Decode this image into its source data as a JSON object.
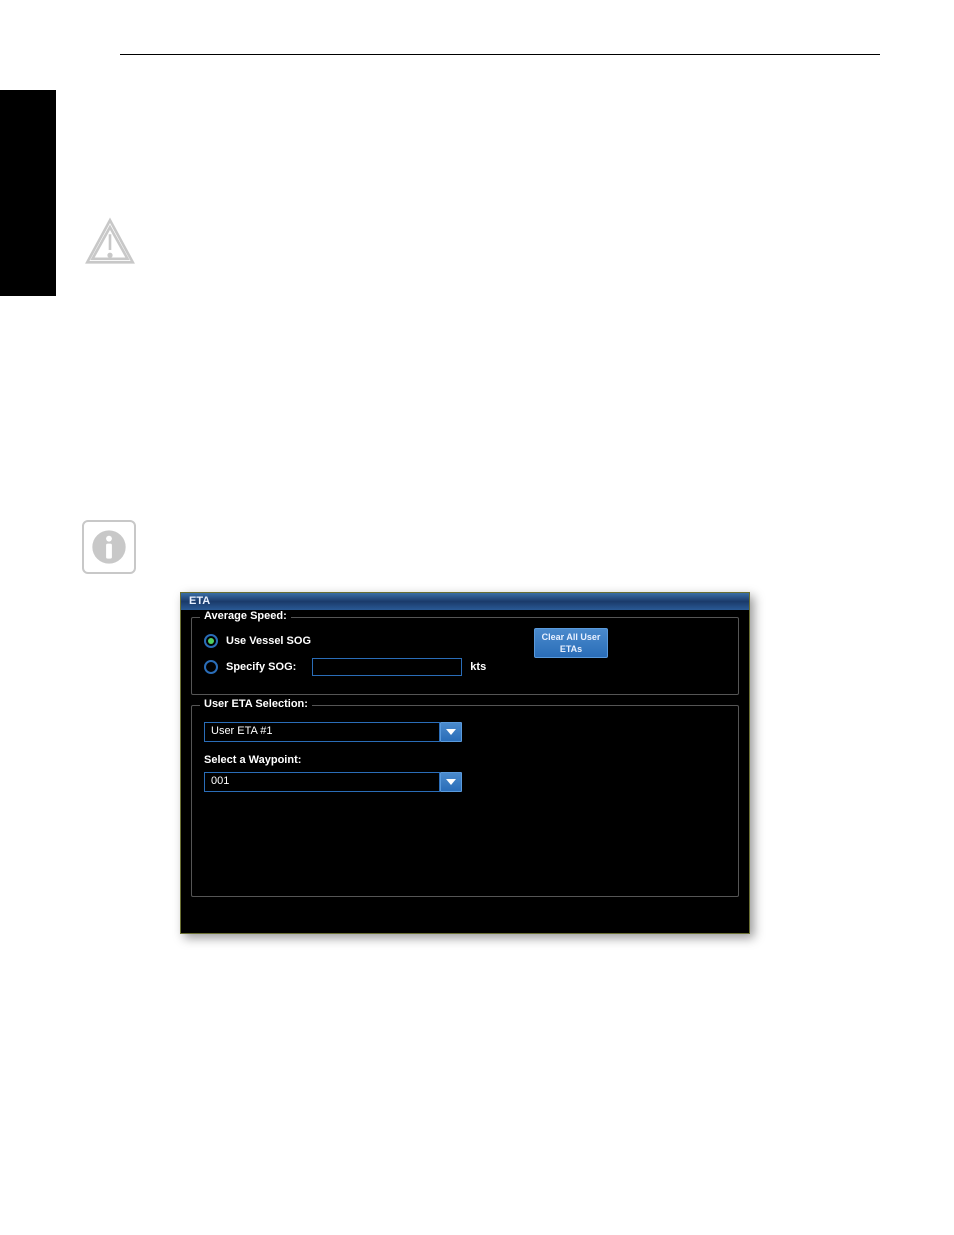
{
  "dialog": {
    "title": "ETA",
    "average_speed": {
      "legend": "Average Speed:",
      "use_vessel_sog_label": "Use Vessel SOG",
      "specify_sog_label": "Specify SOG:",
      "sog_value": "",
      "sog_unit": "kts",
      "clear_button_line1": "Clear All User",
      "clear_button_line2": "ETAs",
      "selected": "use_vessel_sog"
    },
    "user_eta": {
      "legend": "User ETA Selection:",
      "eta_value": "User ETA #1",
      "waypoint_label": "Select a Waypoint:",
      "waypoint_value": "001"
    }
  }
}
